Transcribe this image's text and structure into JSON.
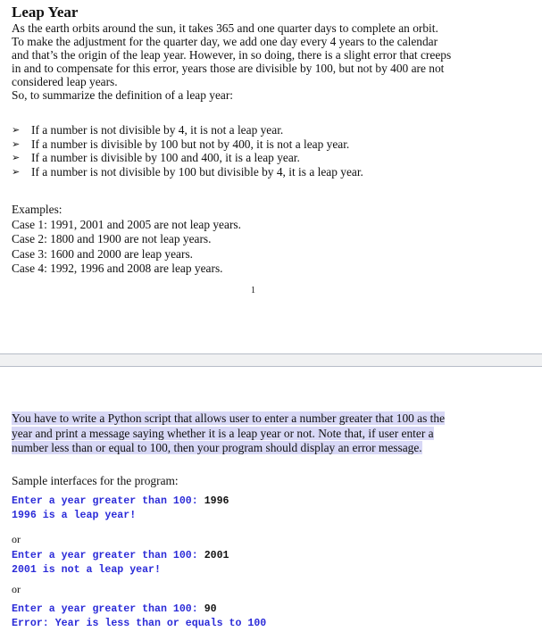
{
  "page1": {
    "title": "Leap Year",
    "intro_lines": [
      "As the earth orbits around the sun, it takes 365 and one quarter days to complete an orbit.",
      "To make the adjustment for the quarter day, we add one day every 4 years to the calendar",
      "and that’s the origin of the leap year. However, in so doing, there is a slight error that creeps",
      "in and to compensate for this error, years those are divisible by 100, but not by 400 are not",
      "considered leap years."
    ],
    "summary_line": "So, to summarize the definition of a leap year:",
    "bullet_icon": "arrowhead-bullet",
    "bullets": [
      "If a number is not divisible by 4, it is not a leap year.",
      "If a number is divisible by 100 but not by 400, it is not a leap year.",
      "If a number is divisible by 100 and 400, it is a leap year.",
      "If a number is not divisible by 100 but divisible by 4, it is a leap year."
    ],
    "examples_heading": "Examples:",
    "examples": [
      "Case 1: 1991, 2001 and 2005 are not leap years.",
      "Case 2: 1800 and 1900 are not leap years.",
      "Case 3: 1600 and 2000 are leap years.",
      "Case 4: 1992, 1996 and 2008 are leap years."
    ],
    "page_number": "1"
  },
  "page2": {
    "task_lines": [
      "You have to write a Python script that allows user to enter a number greater that 100 as the",
      "year and print a message saying whether it is a leap year or not. Note that, if user enter a",
      "number less than or equal to 100, then your program should display an error message."
    ],
    "sample_intro": "Sample interfaces for the program:",
    "separator": "or",
    "samples": [
      {
        "prompt": "Enter a year greater than 100: ",
        "input": "1996",
        "output": "1996 is a leap year!"
      },
      {
        "prompt": "Enter a year greater than 100: ",
        "input": "2001",
        "output": "2001 is not a leap year!"
      },
      {
        "prompt": "Enter a year greater than 100: ",
        "input": "90",
        "output": "Error: Year is less than or equals to 100"
      }
    ]
  },
  "colors": {
    "code_blue": "#2b2bd8",
    "selection_highlight": "#d8d8f6",
    "page_gap": "#f0f1f2"
  }
}
